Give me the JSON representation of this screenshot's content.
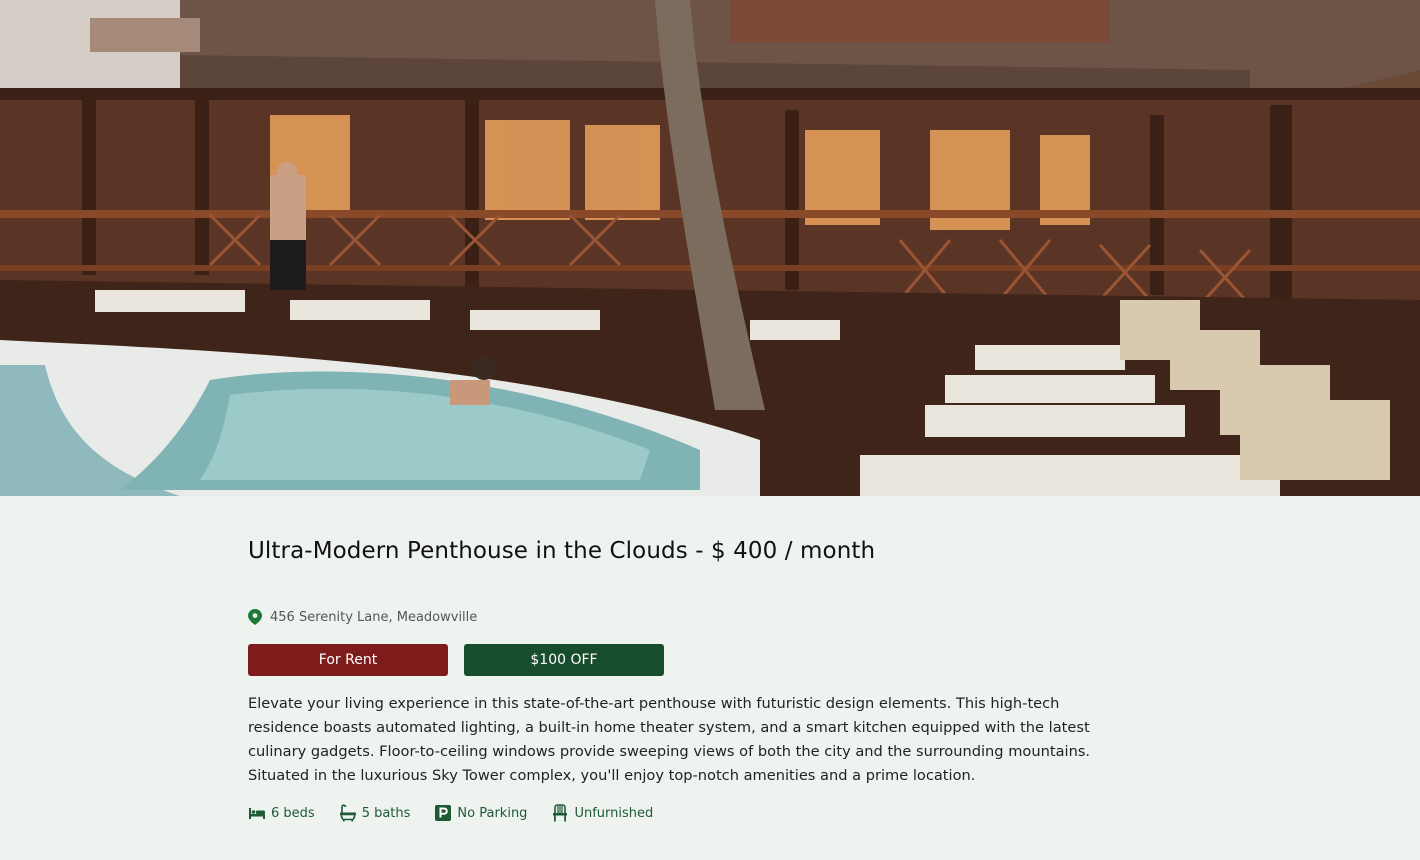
{
  "listing": {
    "title": "Ultra-Modern Penthouse in the Clouds - $ 400 / month",
    "address": "456 Serenity Lane, Meadowville",
    "badges": {
      "status": "For Rent",
      "discount": "$100 OFF"
    },
    "description": "Elevate your living experience in this state-of-the-art penthouse with futuristic design elements. This high-tech residence boasts automated lighting, a built-in home theater system, and a smart kitchen equipped with the latest culinary gadgets. Floor-to-ceiling windows provide sweeping views of both the city and the surrounding mountains. Situated in the luxurious Sky Tower complex, you'll enjoy top-notch amenities and a prime location.",
    "features": {
      "beds": "6 beds",
      "baths": "5 baths",
      "parking": "No Parking",
      "furnishing": "Unfurnished"
    }
  },
  "icons": {
    "location": "map-pin-icon",
    "beds": "bed-icon",
    "baths": "bathtub-icon",
    "parking": "parking-icon",
    "furnishing": "chair-icon"
  },
  "colors": {
    "background": "#eff3f0",
    "for_rent_badge": "#7e1c1c",
    "discount_badge": "#174c2c",
    "feature_text": "#1d5a35",
    "pin": "#1f7a3a"
  }
}
